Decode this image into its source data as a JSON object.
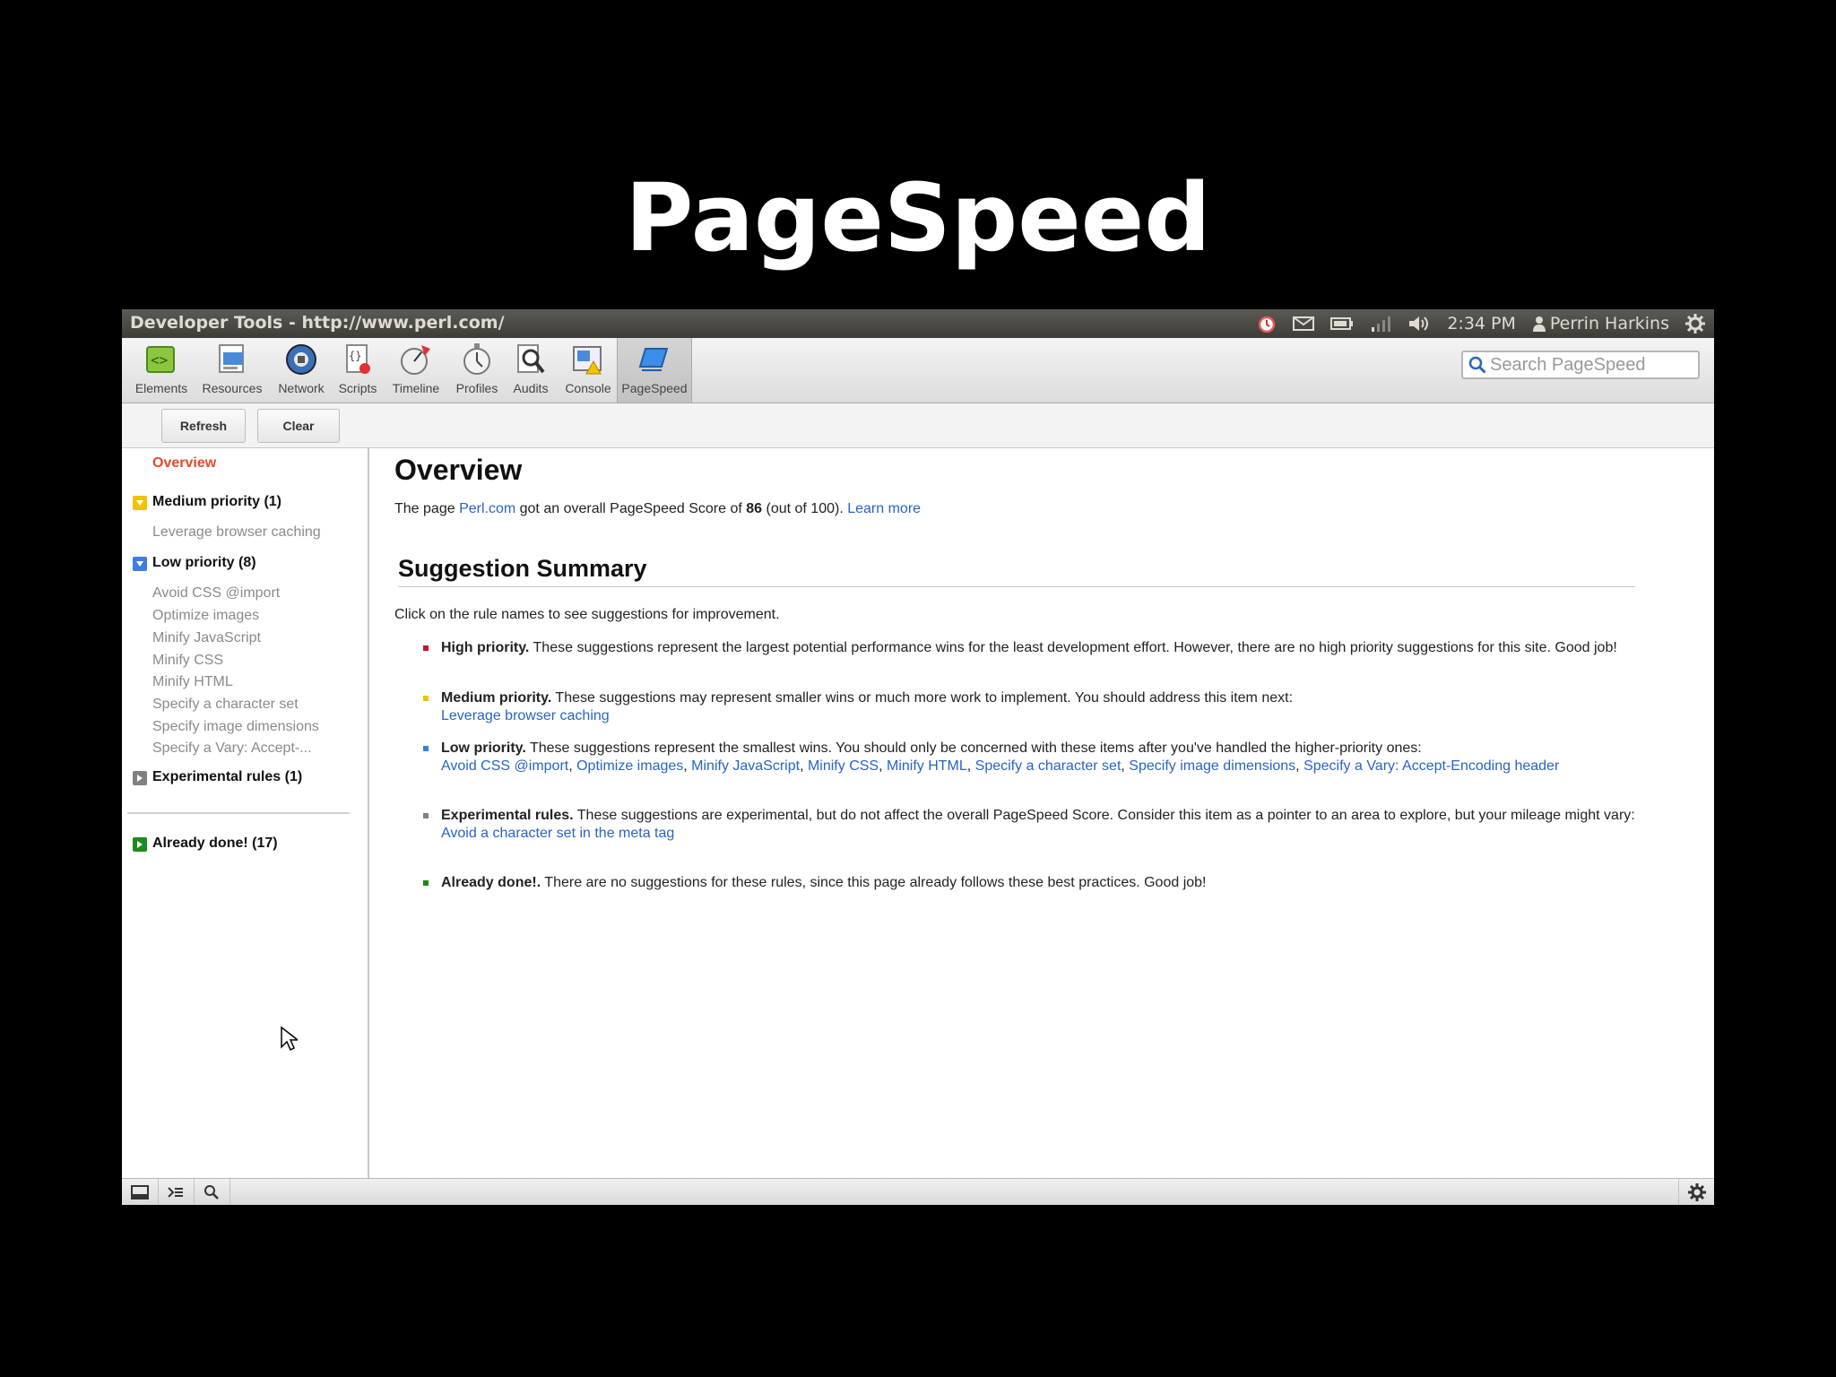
{
  "slide": {
    "title": "PageSpeed"
  },
  "window": {
    "title": "Developer Tools - http://www.perl.com/"
  },
  "tray": {
    "time": "2:34 PM",
    "user": "Perrin Harkins"
  },
  "toolbar": {
    "tools": [
      {
        "label": "Elements",
        "icon": "elements-icon"
      },
      {
        "label": "Resources",
        "icon": "resources-icon"
      },
      {
        "label": "Network",
        "icon": "network-icon"
      },
      {
        "label": "Scripts",
        "icon": "scripts-icon"
      },
      {
        "label": "Timeline",
        "icon": "timeline-icon"
      },
      {
        "label": "Profiles",
        "icon": "profiles-icon"
      },
      {
        "label": "Audits",
        "icon": "audits-icon"
      },
      {
        "label": "Console",
        "icon": "console-icon"
      },
      {
        "label": "PageSpeed",
        "icon": "pagespeed-icon"
      }
    ],
    "active": "PageSpeed",
    "search_placeholder": "Search PageSpeed"
  },
  "actions": {
    "refresh": "Refresh",
    "clear": "Clear"
  },
  "sidebar": {
    "overview": "Overview",
    "medium_group": "Medium priority (1)",
    "medium_items": [
      "Leverage browser caching"
    ],
    "low_group": "Low priority (8)",
    "low_items": [
      "Avoid CSS @import",
      "Optimize images",
      "Minify JavaScript",
      "Minify CSS",
      "Minify HTML",
      "Specify a character set",
      "Specify image dimensions",
      "Specify a Vary: Accept-..."
    ],
    "experimental_group": "Experimental rules (1)",
    "done_group": "Already done! (17)"
  },
  "main": {
    "overview_heading": "Overview",
    "score_prefix": "The page ",
    "site_link": "Perl.com",
    "score_mid": " got an overall PageSpeed Score of ",
    "score": "86",
    "score_suffix": " (out of 100). ",
    "learn_more": "Learn more",
    "summary_heading": "Suggestion Summary",
    "intro": "Click on the rule names to see suggestions for improvement.",
    "high": {
      "label": "High priority.",
      "text": " These suggestions represent the largest potential performance wins for the least development effort. However, there are no high priority suggestions for this site. Good job!"
    },
    "medium": {
      "label": "Medium priority.",
      "text": " These suggestions may represent smaller wins or much more work to implement. You should address this item next:",
      "links": [
        "Leverage browser caching"
      ]
    },
    "low": {
      "label": "Low priority.",
      "text": " These suggestions represent the smallest wins. You should only be concerned with these items after you've handled the higher-priority ones:",
      "links": [
        "Avoid CSS @import",
        "Optimize images",
        "Minify JavaScript",
        "Minify CSS",
        "Minify HTML",
        "Specify a character set",
        "Specify image dimensions",
        "Specify a Vary: Accept-Encoding header"
      ]
    },
    "experimental": {
      "label": "Experimental rules.",
      "text": " These suggestions are experimental, but do not affect the overall PageSpeed Score. Consider this item as a pointer to an area to explore, but your mileage might vary:",
      "links": [
        "Avoid a character set in the meta tag"
      ]
    },
    "done": {
      "label": "Already done!.",
      "text": " There are no suggestions for these rules, since this page already follows these best practices. Good job!"
    }
  },
  "colors": {
    "high": "#c8102e",
    "medium": "#f2c200",
    "low": "#3d7ede",
    "experimental": "#808080",
    "done": "#1d8a1d",
    "link": "#2a63c5",
    "selected": "#e24a2e"
  }
}
